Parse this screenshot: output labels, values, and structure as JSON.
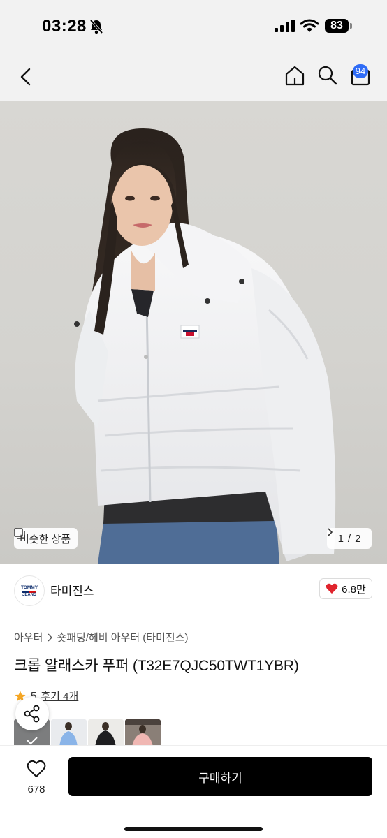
{
  "status_bar": {
    "time": "03:28",
    "battery": "83"
  },
  "header": {
    "cart_count": "94"
  },
  "hero": {
    "similar_label": "비슷한 상품",
    "page_current": "1",
    "page_total": "2"
  },
  "brand": {
    "logo_top": "TOMMY",
    "logo_bottom": "JEANS",
    "name": "타미진스",
    "likes": "6.8만"
  },
  "breadcrumb": [
    "아우터",
    "숏패딩/헤비 아우터 (타미진스)"
  ],
  "product": {
    "title": "크롭 알래스카 푸퍼 (T32E7QJC50TWT1YBR)"
  },
  "rating": {
    "score": "5",
    "reviews": "후기 4개"
  },
  "bottom": {
    "wish_count": "678",
    "buy_label": "구매하기"
  },
  "colors": {
    "accent": "#2f6cf6",
    "heart": "#e0242d",
    "star": "#f5a623",
    "buy_button": "#000000"
  }
}
